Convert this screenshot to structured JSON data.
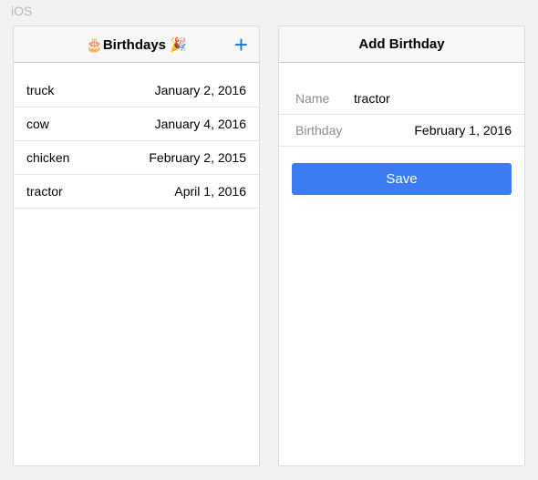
{
  "platform_label": "iOS",
  "list_screen": {
    "title": "🎂Birthdays 🎉",
    "add_icon": "+",
    "rows": [
      {
        "name": "truck",
        "date": "January 2, 2016"
      },
      {
        "name": "cow",
        "date": "January 4, 2016"
      },
      {
        "name": "chicken",
        "date": "February 2, 2015"
      },
      {
        "name": "tractor",
        "date": "April 1, 2016"
      }
    ]
  },
  "form_screen": {
    "title": "Add Birthday",
    "name_label": "Name",
    "name_value": "tractor",
    "birthday_label": "Birthday",
    "birthday_value": "February 1, 2016",
    "save_label": "Save"
  }
}
